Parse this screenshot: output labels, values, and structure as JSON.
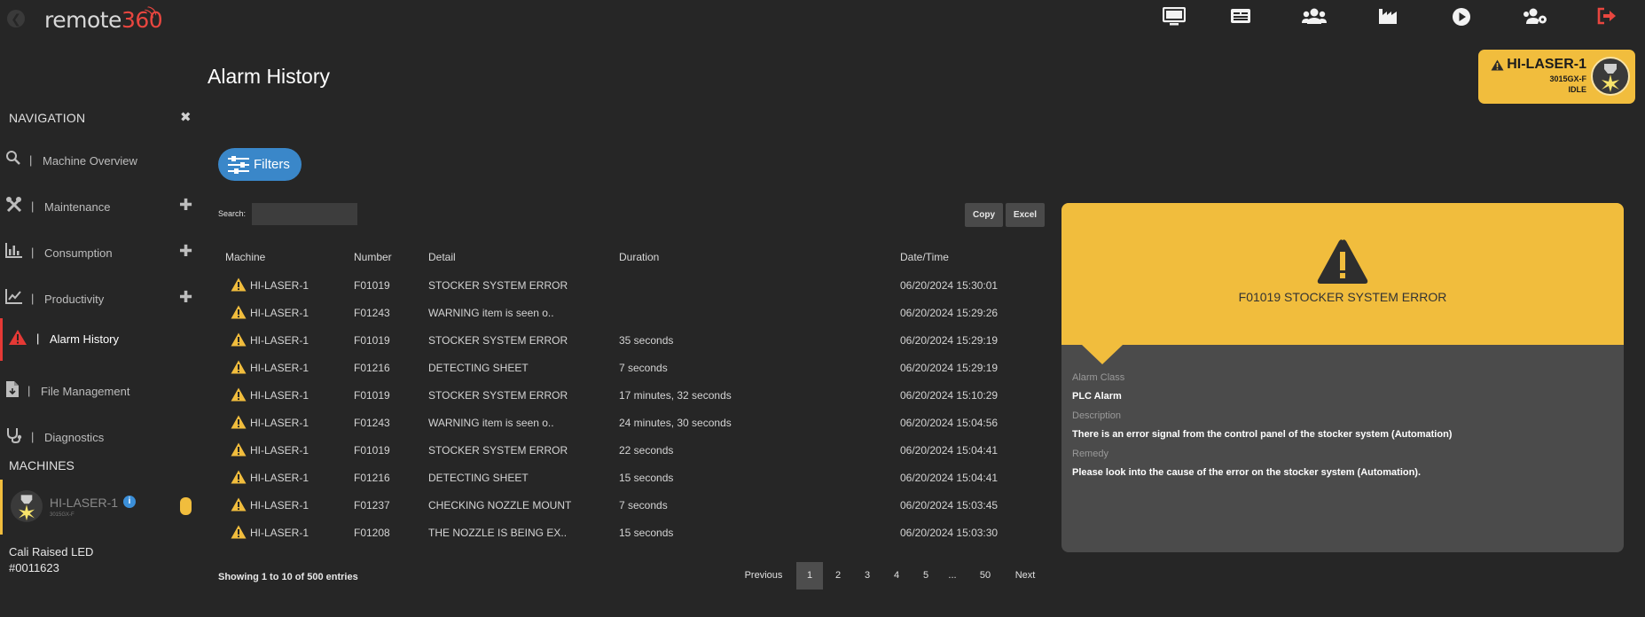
{
  "app": {
    "logo_text": "remote",
    "logo_accent": "360",
    "accent_color": "#f1bd3d",
    "primary_color": "#3a87c9",
    "alert_color": "#e53935"
  },
  "header": {
    "icons": [
      "monitor-icon",
      "card-icon",
      "users-icon",
      "factory-icon",
      "play-icon",
      "users-gear-icon",
      "logout-icon"
    ]
  },
  "page": {
    "title": "Alarm History"
  },
  "machine_badge": {
    "name": "HI-LASER-1",
    "model": "3015GX-F",
    "status": "IDLE"
  },
  "sidebar": {
    "header": "NAVIGATION",
    "close_symbol": "✖",
    "items": [
      {
        "label": "Machine Overview",
        "icon": "search-icon",
        "expandable": false
      },
      {
        "label": "Maintenance",
        "icon": "tools-icon",
        "expandable": true
      },
      {
        "label": "Consumption",
        "icon": "bar-chart-icon",
        "expandable": true
      },
      {
        "label": "Productivity",
        "icon": "line-chart-icon",
        "expandable": true
      },
      {
        "label": "Alarm History",
        "icon": "alert-icon",
        "expandable": false,
        "active": true
      },
      {
        "label": "File Management",
        "icon": "file-icon",
        "expandable": false
      },
      {
        "label": "Diagnostics",
        "icon": "stethoscope-icon",
        "expandable": false
      }
    ],
    "separator": "|",
    "plus_symbol": "✚",
    "machines_header": "MACHINES",
    "machine": {
      "name": "HI-LASER-1",
      "model": "3015GX-F",
      "info_symbol": "i"
    },
    "led_line1": "Cali Raised LED",
    "led_line2": "#0011623"
  },
  "filters": {
    "button_label": "Filters"
  },
  "search": {
    "label": "Search:",
    "value": ""
  },
  "export": {
    "copy_label": "Copy",
    "excel_label": "Excel"
  },
  "table": {
    "columns": [
      "Machine",
      "Number",
      "Detail",
      "Duration",
      "Date/Time"
    ],
    "rows": [
      {
        "machine": "HI-LASER-1",
        "number": "F01019",
        "detail": "STOCKER SYSTEM ERROR",
        "duration": "",
        "datetime": "06/20/2024 15:30:01"
      },
      {
        "machine": "HI-LASER-1",
        "number": "F01243",
        "detail": "WARNING item is seen o..",
        "duration": "",
        "datetime": "06/20/2024 15:29:26"
      },
      {
        "machine": "HI-LASER-1",
        "number": "F01019",
        "detail": "STOCKER SYSTEM ERROR",
        "duration": "35 seconds",
        "datetime": "06/20/2024 15:29:19"
      },
      {
        "machine": "HI-LASER-1",
        "number": "F01216",
        "detail": "DETECTING SHEET",
        "duration": "7 seconds",
        "datetime": "06/20/2024 15:29:19"
      },
      {
        "machine": "HI-LASER-1",
        "number": "F01019",
        "detail": "STOCKER SYSTEM ERROR",
        "duration": "17 minutes, 32 seconds",
        "datetime": "06/20/2024 15:10:29"
      },
      {
        "machine": "HI-LASER-1",
        "number": "F01243",
        "detail": "WARNING item is seen o..",
        "duration": "24 minutes, 30 seconds",
        "datetime": "06/20/2024 15:04:56"
      },
      {
        "machine": "HI-LASER-1",
        "number": "F01019",
        "detail": "STOCKER SYSTEM ERROR",
        "duration": "22 seconds",
        "datetime": "06/20/2024 15:04:41"
      },
      {
        "machine": "HI-LASER-1",
        "number": "F01216",
        "detail": "DETECTING SHEET",
        "duration": "15 seconds",
        "datetime": "06/20/2024 15:04:41"
      },
      {
        "machine": "HI-LASER-1",
        "number": "F01237",
        "detail": "CHECKING NOZZLE MOUNT",
        "duration": "7 seconds",
        "datetime": "06/20/2024 15:03:45"
      },
      {
        "machine": "HI-LASER-1",
        "number": "F01208",
        "detail": "THE NOZZLE IS BEING EX..",
        "duration": "15 seconds",
        "datetime": "06/20/2024 15:03:30"
      }
    ]
  },
  "pagination": {
    "showing": "Showing 1 to 10 of 500 entries",
    "previous": "Previous",
    "next": "Next",
    "pages": [
      "1",
      "2",
      "3",
      "4",
      "5",
      "...",
      "50"
    ],
    "current": "1"
  },
  "detail_panel": {
    "title": "F01019 STOCKER SYSTEM ERROR",
    "alarm_class_label": "Alarm Class",
    "alarm_class": "PLC Alarm",
    "description_label": "Description",
    "description": "There is an error signal from the control panel of the stocker system (Automation)",
    "remedy_label": "Remedy",
    "remedy": "Please look into the cause of the error on the stocker system (Automation)."
  }
}
